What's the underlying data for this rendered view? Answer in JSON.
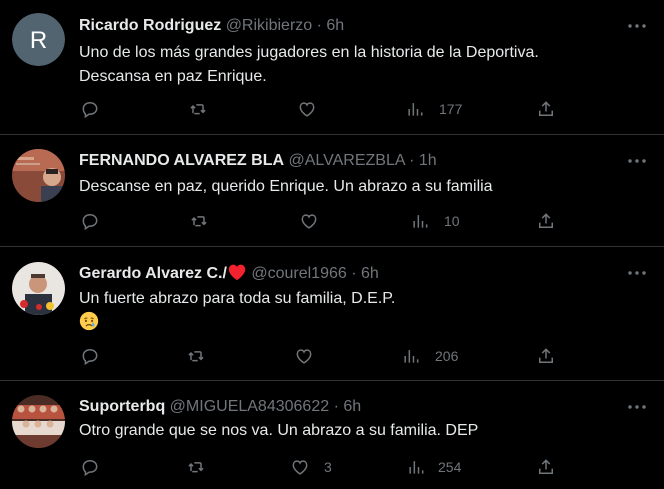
{
  "tweets": [
    {
      "name": "Ricardo Rodriguez",
      "handle": "@Rikibierzo",
      "dot": "·",
      "time": "6h",
      "avatar_letter": "R",
      "avatar_color": "#536471",
      "text_lines": [
        "Uno de los más grandes jugadores en la historia de la Deportiva.",
        "Descansa en paz Enrique."
      ],
      "reply_count": "",
      "retweet_count": "",
      "like_count": "",
      "view_count": "177"
    },
    {
      "name": "FERNANDO ALVAREZ BLA",
      "handle": "@ALVAREZBLA",
      "dot": "·",
      "time": "1h",
      "text_lines": [
        "Descanse en paz, querido Enrique.  Un abrazo a su familia"
      ],
      "reply_count": "",
      "retweet_count": "",
      "like_count": "",
      "view_count": "10"
    },
    {
      "name": "Gerardo Alvarez C./",
      "handle": "@courel1966",
      "dot": "·",
      "time": "6h",
      "text_lines": [
        "Un fuerte abrazo para toda su familia, D.E.P."
      ],
      "emoji_line": "crying-face",
      "reply_count": "",
      "retweet_count": "",
      "like_count": "",
      "view_count": "206"
    },
    {
      "name": "Suporterbq",
      "handle": "@MIGUELA84306622",
      "dot": "·",
      "time": "6h",
      "text_lines": [
        "Otro grande que se nos va. Un abrazo a su familia. DEP"
      ],
      "reply_count": "",
      "retweet_count": "",
      "like_count": "3",
      "view_count": "254"
    }
  ],
  "colors": {
    "background": "#000000",
    "text_primary": "#e7e9ea",
    "text_secondary": "#71767b",
    "divider": "#2f3336",
    "heart_red": "#f4212e"
  }
}
